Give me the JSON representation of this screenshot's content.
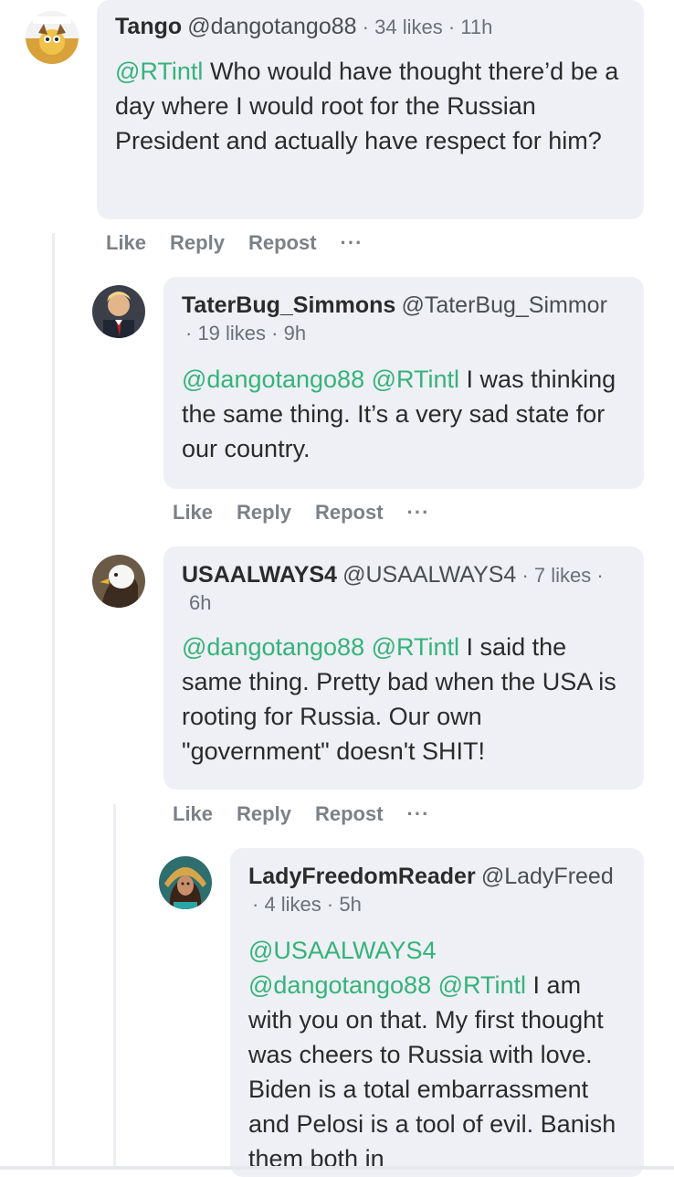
{
  "comments": [
    {
      "name": "Tango",
      "handle": "@dangotango88",
      "sep1": "·",
      "likes": "34 likes",
      "sep2": "·",
      "time": "11h",
      "mention1": "@RTintl",
      "text": " Who would have thought there’d be a day where I would root for the Russian President and actually have respect for him?"
    },
    {
      "name": "TaterBug_Simmons",
      "handle": "@TaterBug_Simmor",
      "line2": "· 19 likes · 9h",
      "mention1": "@dangotango88",
      "mention2": "@RTintl",
      "text": " I was thinking the same thing. It’s a very sad state for our country."
    },
    {
      "name": "USAALWAYS4",
      "handle": "@USAALWAYS4",
      "sep1": "·",
      "likes": "7 likes",
      "sep2": "·",
      "time": "6h",
      "mention1": "@dangotango88",
      "mention2": "@RTintl",
      "text": " I said the same thing. Pretty bad when the USA is rooting for Russia. Our own \"government\" doesn't SHIT!"
    },
    {
      "name": "LadyFreedomReader",
      "handle": "@LadyFreed",
      "line2": "· 4 likes · 5h",
      "mention1": "@USAALWAYS4",
      "mention2": "@dangotango88",
      "mention3": "@RTintl",
      "text": " I am with you on that. My first thought was cheers to Russia with love. Biden is a total embarrassment and Pelosi is a tool of evil. Banish them both in"
    }
  ],
  "actions": {
    "like": "Like",
    "reply": "Reply",
    "repost": "Repost",
    "more": "···"
  },
  "colors": {
    "mention": "#35b37a",
    "bubble": "#eef0f5",
    "action_text": "#7c8087"
  },
  "icons": {
    "tango_avatar": "dog-avatar-icon",
    "tater_avatar": "man-avatar-icon",
    "usa_avatar": "eagle-avatar-icon",
    "lady_avatar": "woman-avatar-icon",
    "more": "more-dots-icon"
  }
}
